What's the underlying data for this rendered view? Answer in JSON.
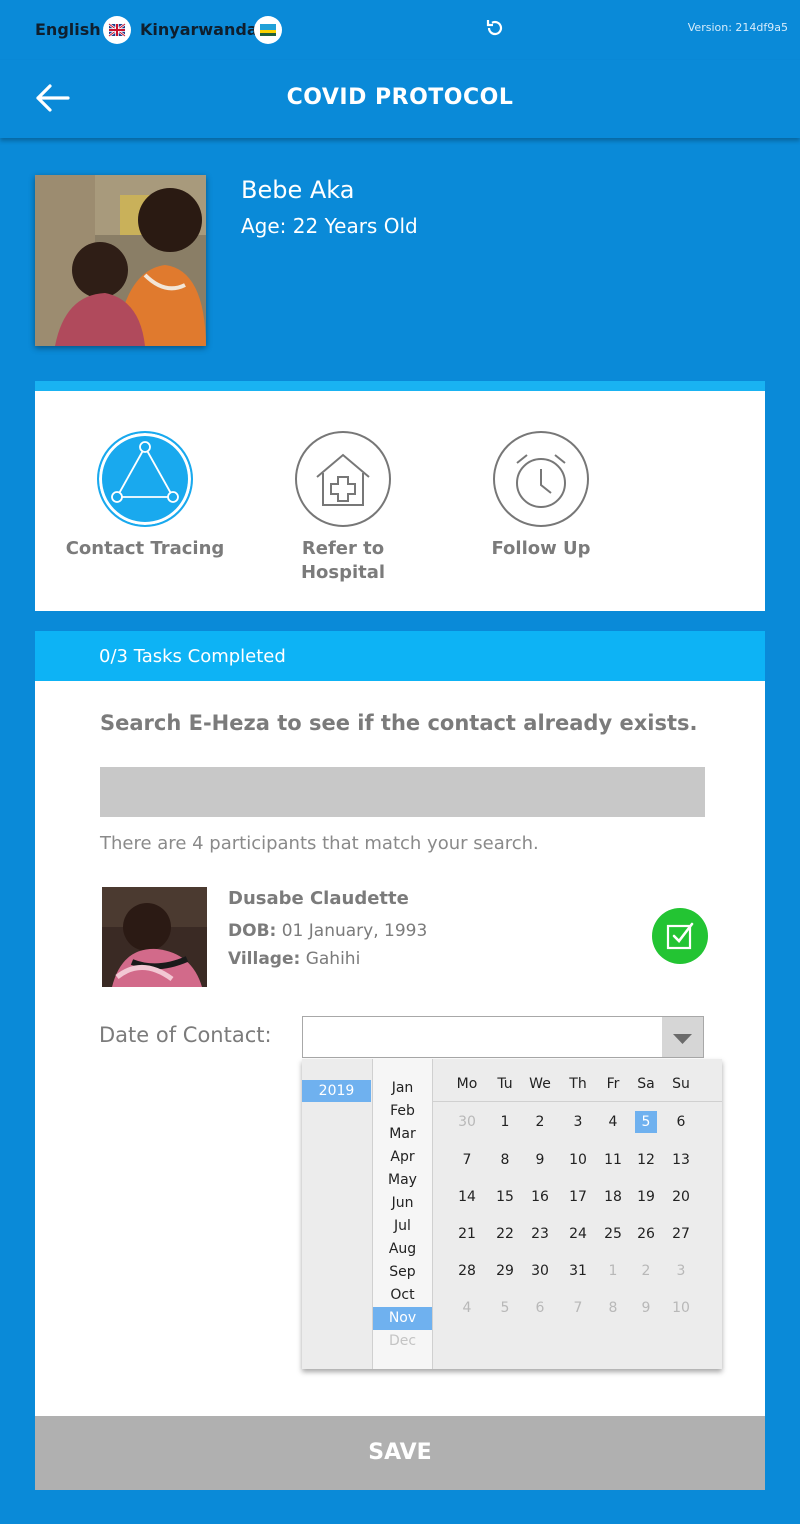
{
  "topbar": {
    "lang_english": "English",
    "lang_kinyarwanda": "Kinyarwanda",
    "version": "Version: 214df9a5"
  },
  "header": {
    "title": "COVID PROTOCOL"
  },
  "person": {
    "name": "Bebe Aka",
    "age": "Age: 22 Years Old"
  },
  "activities": [
    {
      "label": "Contact Tracing",
      "icon": "triangle-network-icon",
      "active": true
    },
    {
      "label": "Refer to Hospital",
      "icon": "hospital-icon",
      "active": false
    },
    {
      "label": "Follow Up",
      "icon": "alarm-clock-icon",
      "active": false
    }
  ],
  "tasks": {
    "completed_text": "0/3 Tasks Completed"
  },
  "search": {
    "instruction": "Search E-Heza to see if the contact already exists.",
    "value": "",
    "match_text": "There are 4 participants that match your search."
  },
  "participant": {
    "name": "Dusabe Claudette",
    "dob_label": "DOB:",
    "dob": "01 January, 1993",
    "village_label": "Village:",
    "village": "Gahihi"
  },
  "date_of_contact": {
    "label": "Date of Contact:",
    "value": ""
  },
  "datepicker": {
    "year": "2019",
    "months": [
      "Jan",
      "Feb",
      "Mar",
      "Apr",
      "May",
      "Jun",
      "Jul",
      "Aug",
      "Sep",
      "Oct",
      "Nov",
      "Dec"
    ],
    "selected_month": "Nov",
    "weekdays": [
      "Mo",
      "Tu",
      "We",
      "Th",
      "Fr",
      "Sa",
      "Su"
    ],
    "weeks": [
      [
        "30",
        "1",
        "2",
        "3",
        "4",
        "5",
        "6"
      ],
      [
        "7",
        "8",
        "9",
        "10",
        "11",
        "12",
        "13"
      ],
      [
        "14",
        "15",
        "16",
        "17",
        "18",
        "19",
        "20"
      ],
      [
        "21",
        "22",
        "23",
        "24",
        "25",
        "26",
        "27"
      ],
      [
        "28",
        "29",
        "30",
        "31",
        "1",
        "2",
        "3"
      ],
      [
        "4",
        "5",
        "6",
        "7",
        "8",
        "9",
        "10"
      ]
    ],
    "selected_day": "5"
  },
  "save_label": "SAVE"
}
